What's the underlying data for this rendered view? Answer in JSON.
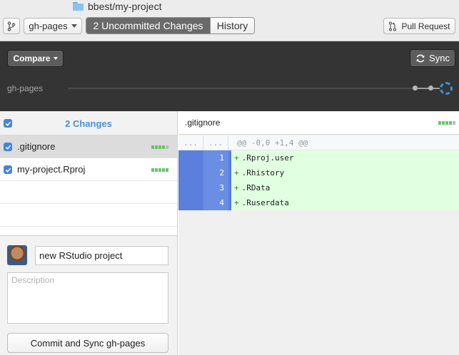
{
  "window": {
    "title": "bbest/my-project"
  },
  "toolbar": {
    "branch": "gh-pages",
    "tabs": [
      {
        "label": "2 Uncommitted Changes",
        "active": true
      },
      {
        "label": "History",
        "active": false
      }
    ],
    "pull_request": "Pull Request"
  },
  "compare_bar": {
    "compare_label": "Compare",
    "sync_label": "Sync",
    "branch_label": "gh-pages"
  },
  "changes": {
    "title": "2 Changes",
    "files": [
      {
        "name": ".gitignore",
        "selected": true
      },
      {
        "name": "my-project.Rproj",
        "selected": false
      }
    ]
  },
  "commit": {
    "summary": "new RStudio project",
    "description_placeholder": "Description",
    "button_label": "Commit and Sync gh-pages"
  },
  "diff": {
    "file": ".gitignore",
    "gutter_placeholder": "...",
    "hunk_header": "@@ -0,0 +1,4 @@",
    "lines": [
      {
        "num": "1",
        "text": ".Rproj.user"
      },
      {
        "num": "2",
        "text": ".Rhistory"
      },
      {
        "num": "3",
        "text": ".RData"
      },
      {
        "num": "4",
        "text": ".Ruserdata"
      }
    ]
  },
  "colors": {
    "accent": "#4a90d9",
    "added_bg": "#e1ffe1",
    "gutter_blue": "#5a7fdc",
    "dark_bar": "#343434"
  }
}
